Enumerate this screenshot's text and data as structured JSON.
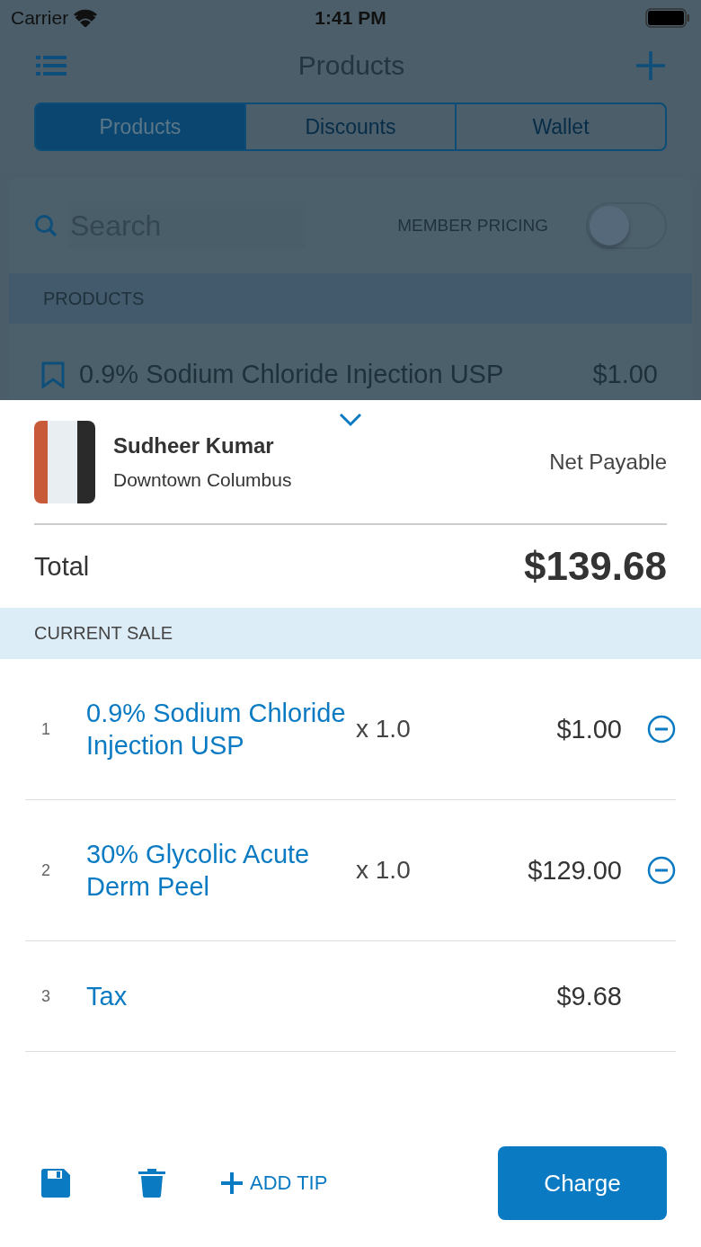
{
  "status_bar": {
    "carrier": "Carrier",
    "time": "1:41 PM"
  },
  "nav": {
    "title": "Products"
  },
  "tabs": [
    {
      "label": "Products",
      "selected": true
    },
    {
      "label": "Discounts",
      "selected": false
    },
    {
      "label": "Wallet",
      "selected": false
    }
  ],
  "search": {
    "placeholder": "Search"
  },
  "member_pricing": {
    "label": "MEMBER PRICING",
    "on": false
  },
  "products_section": {
    "header": "PRODUCTS",
    "items": [
      {
        "name": "0.9% Sodium Chloride Injection USP",
        "price": "$1.00"
      }
    ]
  },
  "sale": {
    "customer": {
      "name": "Sudheer Kumar",
      "location": "Downtown Columbus"
    },
    "net_payable_label": "Net Payable",
    "total_label": "Total",
    "total": "$139.68",
    "section_header": "CURRENT SALE",
    "items": [
      {
        "kind": "product",
        "index": "1",
        "name": "0.9% Sodium Chloride Injection USP",
        "qty": "x 1.0",
        "amount": "$1.00"
      },
      {
        "kind": "product",
        "index": "2",
        "name": "30% Glycolic Acute Derm Peel",
        "qty": "x 1.0",
        "amount": "$129.00"
      },
      {
        "kind": "tax",
        "index": "3",
        "name": "Tax",
        "amount": "$9.68"
      }
    ],
    "add_tip": "ADD TIP",
    "charge": "Charge"
  }
}
